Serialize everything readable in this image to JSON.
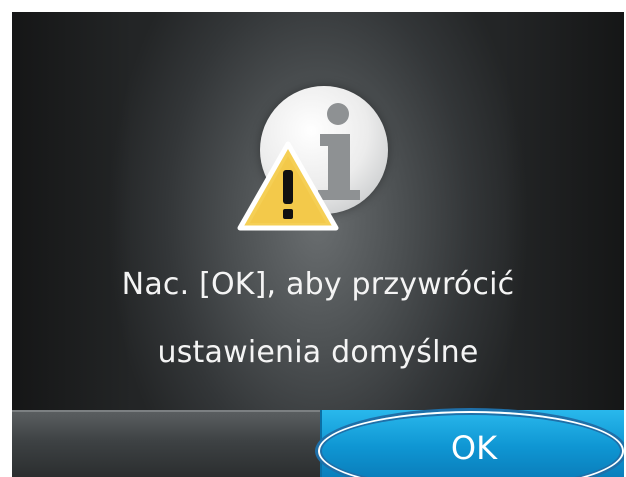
{
  "dialog": {
    "message_line1": "Nac. [OK], aby przywrócić",
    "message_line2": "ustawienia domyślne",
    "icons": [
      "info-icon",
      "warning-icon"
    ]
  },
  "buttons": {
    "ok_label": "OK"
  },
  "colors": {
    "ok_button": "#0f96d3",
    "warning_fill": "#f5cf55",
    "background": "#4c5052"
  }
}
